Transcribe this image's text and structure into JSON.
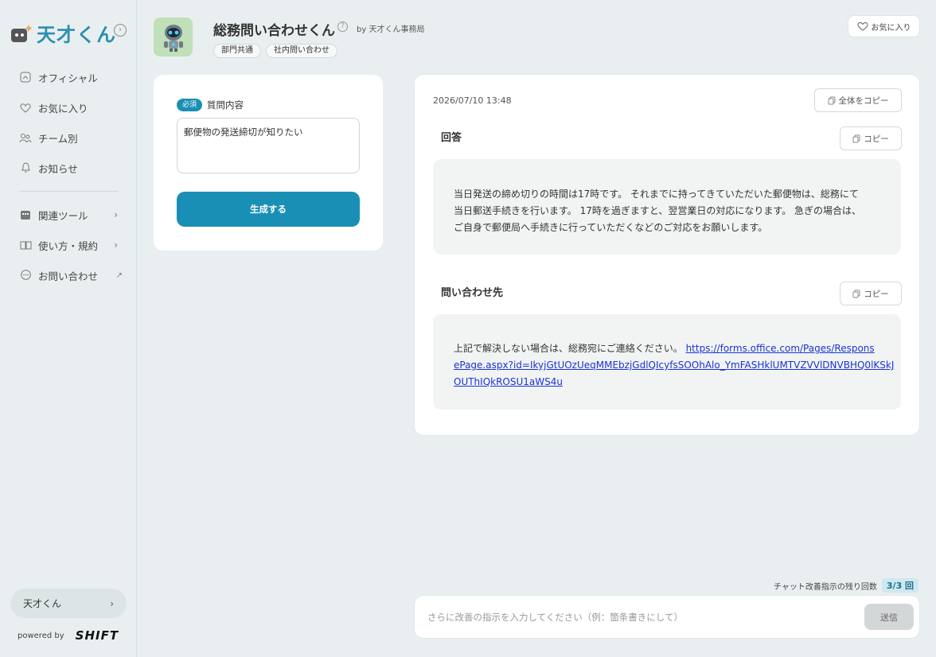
{
  "app": {
    "logo_text": "天才くん",
    "collapse_icon": "chevron-right-circle-icon"
  },
  "sidebar": {
    "items": [
      {
        "label": "オフィシャル",
        "icon": "home-icon"
      },
      {
        "label": "お気に入り",
        "icon": "heart-icon"
      },
      {
        "label": "チーム別",
        "icon": "team-icon"
      },
      {
        "label": "お知らせ",
        "icon": "bell-icon"
      }
    ],
    "sub_items": [
      {
        "label": "関連ツール",
        "icon": "tools-icon",
        "trailing": "›"
      },
      {
        "label": "使い方・規約",
        "icon": "book-icon",
        "trailing": "›"
      },
      {
        "label": "お問い合わせ",
        "icon": "chat-bubble-icon",
        "trailing": "↗"
      }
    ],
    "bottom_pill": {
      "label": "天才くん",
      "trailing": "›"
    },
    "powered_by": "powered by",
    "brand": "SHIFT"
  },
  "header": {
    "title": "総務問い合わせくん",
    "by_line": "by 天才くん事務局",
    "tags": [
      "部門共通",
      "社内問い合わせ"
    ],
    "favorite_label": "お気に入り"
  },
  "form": {
    "required_badge": "必須",
    "field_label": "質問内容",
    "question_value": "郵便物の発送締切が知りたい",
    "generate_label": "生成する"
  },
  "result": {
    "timestamp": "2026/07/10 13:48",
    "copy_all_label": "全体をコピー",
    "sections": [
      {
        "title": "回答",
        "copy_label": "コピー",
        "lines": [
          "当日発送の締め切りの時間は17時です。 それまでに持ってきていただいた郵便物は、総務にて",
          "当日郵送手続きを行います。 17時を過ぎますと、翌営業日の対応になります。 急ぎの場合は、",
          "ご自身で郵便局へ手続きに行っていただくなどのご対応をお願いします。"
        ]
      },
      {
        "title": "問い合わせ先",
        "copy_label": "コピー",
        "text": "上記で解決しない場合は、総務宛にご連絡ください。 ",
        "link_lines": [
          "https://forms.office.com/Pages/Respons",
          "ePage.aspx?id=IkyjGtUOzUeqMMEbzjGdlQIcyfsSOOhAlo_YmFASHklUMTVZVVlDNVBHQ0lKSkJ",
          "OUThIQkROSU1aWS4u"
        ]
      }
    ]
  },
  "chat": {
    "remaining_label": "チャット改善指示の残り回数",
    "remaining_count": "3/3 回",
    "placeholder": "さらに改善の指示を入力してください（例：箇条書きにして）",
    "send_label": "送信"
  },
  "colors": {
    "accent": "#1a8fb5",
    "background": "#e9eff0",
    "link": "#1a33d6"
  }
}
